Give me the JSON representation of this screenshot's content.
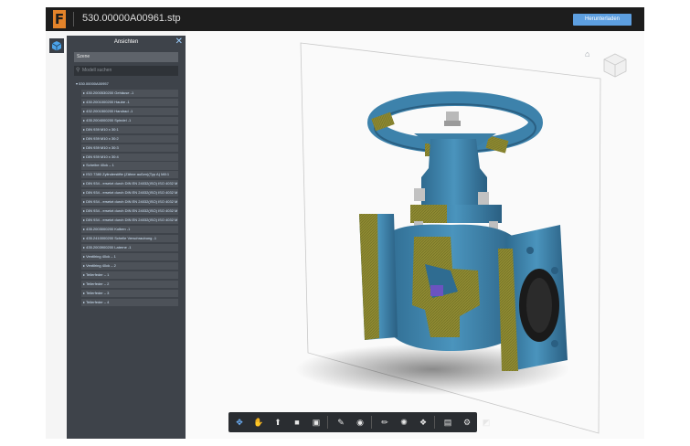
{
  "header": {
    "logo_letter": "F",
    "file_name": "530.00000A00961.stp",
    "download_label": "Herunterladen"
  },
  "panel": {
    "title": "Ansichten",
    "scene_label": "Szene",
    "search_placeholder": "Modell suchen",
    "tree": [
      {
        "label": "530.00000A00957",
        "level": 0
      },
      {
        "label": "430.2000530200 Gehäuse -1",
        "level": 1
      },
      {
        "label": "430.2001000200 Haube -1",
        "level": 1
      },
      {
        "label": "432.2001500200 Handrad -1",
        "level": 1
      },
      {
        "label": "435.2004000200 Spindel -1",
        "level": 1
      },
      {
        "label": "DIN 939 M10 x 30:1",
        "level": 1
      },
      {
        "label": "DIN 939 M10 x 30:2",
        "level": 1
      },
      {
        "label": "DIN 939 M10 x 30:3",
        "level": 1
      },
      {
        "label": "DIN 939 M10 x 30:4",
        "level": 1
      },
      {
        "label": "Scheibe 40ck – 1",
        "level": 1
      },
      {
        "label": "ISO 7380 Zylinderstifte (Zähne außen)(Typ A) M8:1",
        "level": 1
      },
      {
        "label": "DIN 934 - ersetzt durch DIN EN 24032(ISO) ISO 4032 M",
        "level": 1
      },
      {
        "label": "DIN 934 - ersetzt durch DIN EN 24032(ISO) ISO 4032 M",
        "level": 1
      },
      {
        "label": "DIN 934 - ersetzt durch DIN EN 24032(ISO) ISO 4032 M",
        "level": 1
      },
      {
        "label": "DIN 934 - ersetzt durch DIN EN 24032(ISO) ISO 4032 M",
        "level": 1
      },
      {
        "label": "DIN 934 - ersetzt durch DIN EN 24032(ISO) ISO 4032 M",
        "level": 1
      },
      {
        "label": "435.2003000200 Kolben -1",
        "level": 1
      },
      {
        "label": "435.2410000200 Schelle Verschraubung -1",
        "level": 1
      },
      {
        "label": "435.2003900200 Laterne -1",
        "level": 1
      },
      {
        "label": "Ventilring 40ck – 1",
        "level": 1
      },
      {
        "label": "Ventilring 40ck – 2",
        "level": 1
      },
      {
        "label": "Teilerfeder – 1",
        "level": 1
      },
      {
        "label": "Teilerfeder – 2",
        "level": 1
      },
      {
        "label": "Teilerfeder – 3",
        "level": 1
      },
      {
        "label": "Teilerfeder – 4",
        "level": 1
      }
    ]
  },
  "toolbar": {
    "groups": [
      [
        "orbit-icon",
        "pan-icon",
        "look-icon",
        "camera-icon",
        "fit-icon"
      ],
      [
        "section-icon",
        "visibility-icon"
      ],
      [
        "measure-icon",
        "explode-icon",
        "model-browser-icon"
      ],
      [
        "properties-icon",
        "settings-icon",
        "fullscreen-icon"
      ]
    ]
  },
  "colors": {
    "accent": "#5d9fe0",
    "brand": "#e3832a",
    "model_body": "#3c7fa6",
    "section_fill": "#8e8a32"
  }
}
